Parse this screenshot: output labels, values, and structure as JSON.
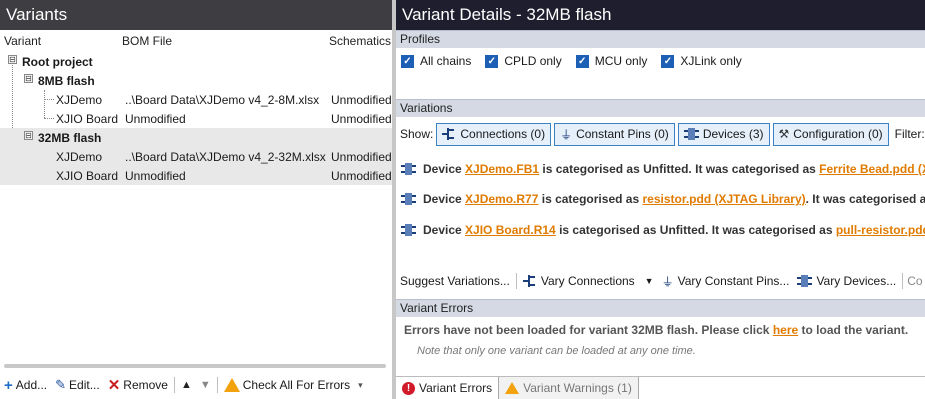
{
  "left": {
    "title": "Variants",
    "columns": [
      "Variant",
      "BOM File",
      "Schematics"
    ],
    "tree": [
      {
        "label": "Root project",
        "bom": "",
        "schem": "",
        "level": 0,
        "toggle": "⊟",
        "bold": true,
        "selected": false
      },
      {
        "label": "8MB flash",
        "bom": "",
        "schem": "",
        "level": 1,
        "toggle": "⊟",
        "bold": true,
        "selected": false
      },
      {
        "label": "XJDemo",
        "bom": "..\\Board Data\\XJDemo v4_2-8M.xlsx",
        "schem": "Unmodified",
        "level": 2,
        "toggle": "",
        "bold": false,
        "selected": false
      },
      {
        "label": "XJIO Board",
        "bom": "Unmodified",
        "schem": "Unmodified",
        "level": 2,
        "toggle": "",
        "bold": false,
        "selected": false
      },
      {
        "label": "32MB flash",
        "bom": "",
        "schem": "",
        "level": 1,
        "toggle": "⊟",
        "bold": true,
        "selected": true
      },
      {
        "label": "XJDemo",
        "bom": "..\\Board Data\\XJDemo v4_2-32M.xlsx",
        "schem": "Unmodified",
        "level": 2,
        "toggle": "",
        "bold": false,
        "selected": true
      },
      {
        "label": "XJIO Board",
        "bom": "Unmodified",
        "schem": "Unmodified",
        "level": 2,
        "toggle": "",
        "bold": false,
        "selected": true
      }
    ],
    "toolbar": {
      "add": "Add...",
      "edit": "Edit...",
      "remove": "Remove",
      "check": "Check All For Errors"
    }
  },
  "right": {
    "title": "Variant Details - 32MB flash",
    "profiles_header": "Profiles",
    "profiles": [
      "All chains",
      "CPLD only",
      "MCU only",
      "XJLink only"
    ],
    "variations_header": "Variations",
    "show_label": "Show:",
    "filters": [
      "Connections (0)",
      "Constant Pins (0)",
      "Devices (3)",
      "Configuration (0)"
    ],
    "filter_label": "Filter:",
    "variations": [
      {
        "prefix": "Device ",
        "device": "XJDemo.FB1",
        "mid": " is categorised as Unfitted. It was categorised as ",
        "link": "Ferrite Bead.pdd (X"
      },
      {
        "prefix": "Device ",
        "device": "XJDemo.R77",
        "mid": " is categorised as ",
        "link": "resistor.pdd (XJTAG Library)",
        "tail": ". It was categorised as"
      },
      {
        "prefix": "Device ",
        "device": "XJIO Board.R14",
        "mid": " is categorised as Unfitted. It was categorised as ",
        "link": "pull-resistor.pdd"
      }
    ],
    "suggest": {
      "suggest": "Suggest Variations...",
      "vary_connections": "Vary Connections",
      "vary_pins": "Vary Constant Pins...",
      "vary_devices": "Vary Devices...",
      "more": "Co"
    },
    "errors_header": "Variant Errors",
    "errors_msg_pre": "Errors have not been loaded for variant 32MB flash. Please click ",
    "errors_msg_link": "here",
    "errors_msg_post": " to load the variant.",
    "errors_note": "Note that only one variant can be loaded at any one time.",
    "tabs": [
      "Variant Errors",
      "Variant Warnings (1)"
    ]
  }
}
